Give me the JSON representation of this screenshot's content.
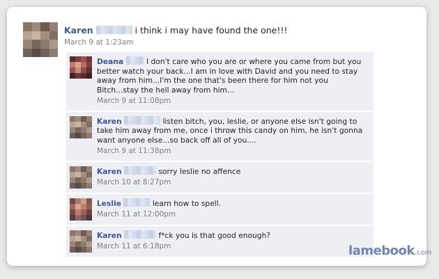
{
  "post": {
    "author": "Karen",
    "text": "i think i may have found the one!!!",
    "time": "March 9 at 1:23am"
  },
  "comments": [
    {
      "author": "Deana",
      "text": "I don't care who you are or where you came from but you better watch your back...I am in love with David and you need to stay away from him...I'm the one that's been there for him not you Bitch...stay the hell away from him...",
      "time": "March 9 at 11:08pm"
    },
    {
      "author": "Karen",
      "text": "listen bitch, you, leslie, or anyone else isn't going to take him away from me, once i throw this candy on him, he isn't gonna want anyone else...so back off all of you....",
      "time": "March 9 at 11:38pm"
    },
    {
      "author": "Karen",
      "text": "sorry leslie no affence",
      "time": "March 10 at 8:27pm"
    },
    {
      "author": "Leslie",
      "text": "learn how to spell.",
      "time": "March 11 at 12:00pm"
    },
    {
      "author": "Karen",
      "text": "f*ck you is that good enough?",
      "time": "March 11 at 6:18pm"
    }
  ],
  "logo": {
    "main": "lamebook",
    "suffix": ".com"
  }
}
